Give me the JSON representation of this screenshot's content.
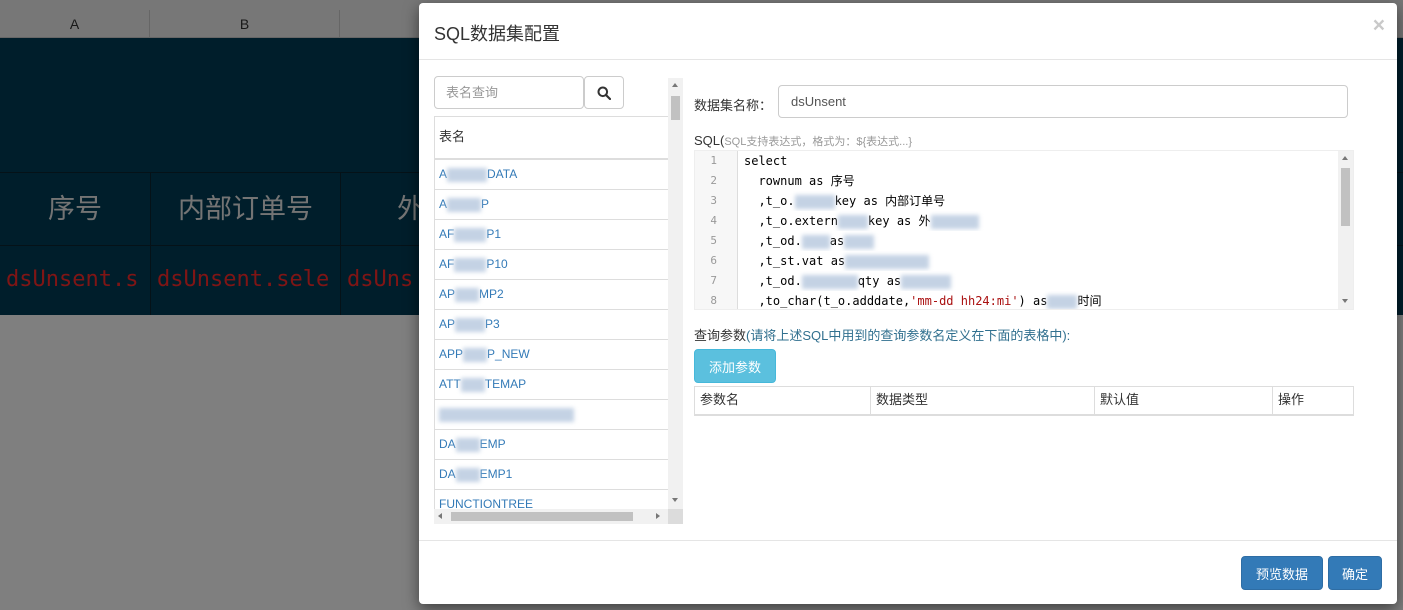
{
  "sheet": {
    "columns": [
      "A",
      "B"
    ],
    "header_cells": [
      "序号",
      "内部订单号",
      "外"
    ],
    "data_cells": [
      "dsUnsent.s",
      "dsUnsent.sele",
      "dsUns"
    ]
  },
  "modal": {
    "title": "SQL数据集配置",
    "close_label": "×",
    "search": {
      "placeholder": "表名查询"
    },
    "table_header": "表名",
    "table_rows": [
      "A",
      "A",
      "AF",
      "AF",
      "AP",
      "AP",
      "APP",
      "ATT",
      "",
      "DA",
      "DA",
      "FUNCTIONTREE"
    ],
    "table_rows_tail": [
      "DATA",
      "P",
      "P1",
      "P10",
      "MP2",
      "P3",
      "P_NEW",
      "TEMAP",
      "",
      "EMP",
      "EMP1",
      ""
    ],
    "dataset_name_label": "数据集名称：",
    "dataset_name_value": "dsUnsent",
    "sql_label": "SQL(",
    "sql_hint": "SQL支持表达式，格式为：${表达式...}",
    "line_numbers": [
      "1",
      "2",
      "3",
      "4",
      "5",
      "6",
      "7",
      "8"
    ],
    "code_lines": [
      "select",
      "  rownum as 序号",
      "  ,t_o.",
      "  ,t_o.extern",
      "  ,t_od.",
      "  ,t_st.vat as",
      "  ,t_od.",
      "  ,to_char(t_o.adddate,"
    ],
    "code_lines_tail": [
      "",
      "",
      "key as 内部订单号",
      "key as 外",
      "as",
      "",
      "qty as",
      "'mm-dd hh24:mi'"
    ],
    "code_line8_end": ") as",
    "code_line8_end2": "时间",
    "param_label": "查询参数",
    "param_hint": "(请将上述SQL中用到的查询参数名定义在下面的表格中):",
    "add_param_button": "添加参数",
    "param_columns": [
      "参数名",
      "数据类型",
      "默认值",
      "操作"
    ],
    "preview_button": "预览数据",
    "confirm_button": "确定"
  }
}
